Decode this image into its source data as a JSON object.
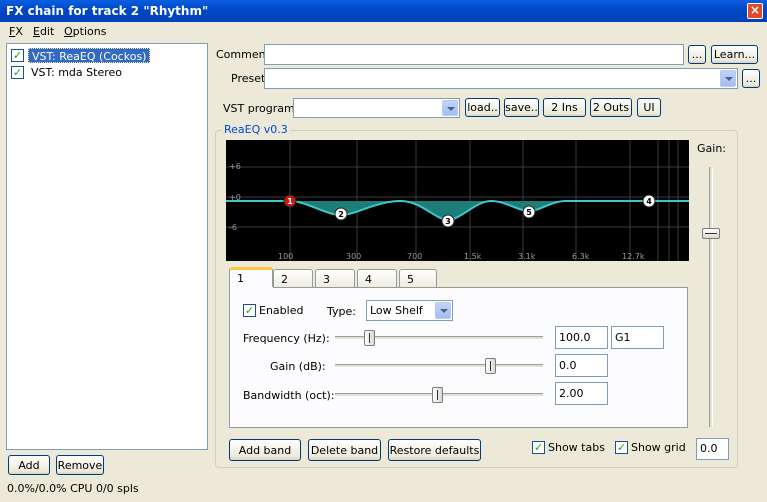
{
  "window": {
    "title": "FX chain for track 2 \"Rhythm\"",
    "close": "×"
  },
  "menu": [
    {
      "label": "FX",
      "underline": "F",
      "rest": "X"
    },
    {
      "label": "Edit",
      "underline": "E",
      "rest": "dit"
    },
    {
      "label": "Options",
      "underline": "O",
      "rest": "ptions"
    }
  ],
  "fx_list": [
    {
      "label": "VST: ReaEQ (Cockos)",
      "checked": true,
      "selected": true
    },
    {
      "label": "VST: mda Stereo",
      "checked": true,
      "selected": false
    }
  ],
  "footer": {
    "add": "Add",
    "remove": "Remove",
    "status": "0.0%/0.0% CPU 0/0 spls"
  },
  "top": {
    "comment_label": "Comment:",
    "comment_value": "",
    "comment_more": "...",
    "learn": "Learn...",
    "preset_label": "Preset:",
    "preset_value": "",
    "preset_more": "...",
    "vst_program_label": "VST program:",
    "vst_program_value": "",
    "load": "load..",
    "save": "save..",
    "ins": "2 Ins",
    "outs": "2 Outs",
    "ui": "UI"
  },
  "plugin": {
    "title": "ReaEQ v0.3",
    "gain_label": "Gain:",
    "gain_value": "0.0",
    "db_labels": [
      "+6",
      "+0",
      "-6"
    ],
    "freq_labels": [
      "100",
      "300",
      "700",
      "1.5k",
      "3.1k",
      "6.3k",
      "12.7k"
    ],
    "bands": [
      "1",
      "2",
      "3",
      "4",
      "5"
    ],
    "active_tab": "1",
    "curve_color": "#3cc8c8",
    "fill_color": "#1e7d78",
    "enabled_label": "Enabled",
    "type_label": "Type:",
    "type_value": "Low Shelf",
    "frequency_label": "Frequency (Hz):",
    "frequency_value": "100.0",
    "note_value": "G1",
    "gain_db_label": "Gain (dB):",
    "gain_db_value": "0.0",
    "bandwidth_label": "Bandwidth (oct):",
    "bandwidth_value": "2.00",
    "add_band": "Add band",
    "delete_band": "Delete band",
    "restore_defaults": "Restore defaults",
    "show_tabs": "Show tabs",
    "show_grid": "Show grid",
    "show_tabs_checked": true,
    "show_grid_checked": true
  }
}
